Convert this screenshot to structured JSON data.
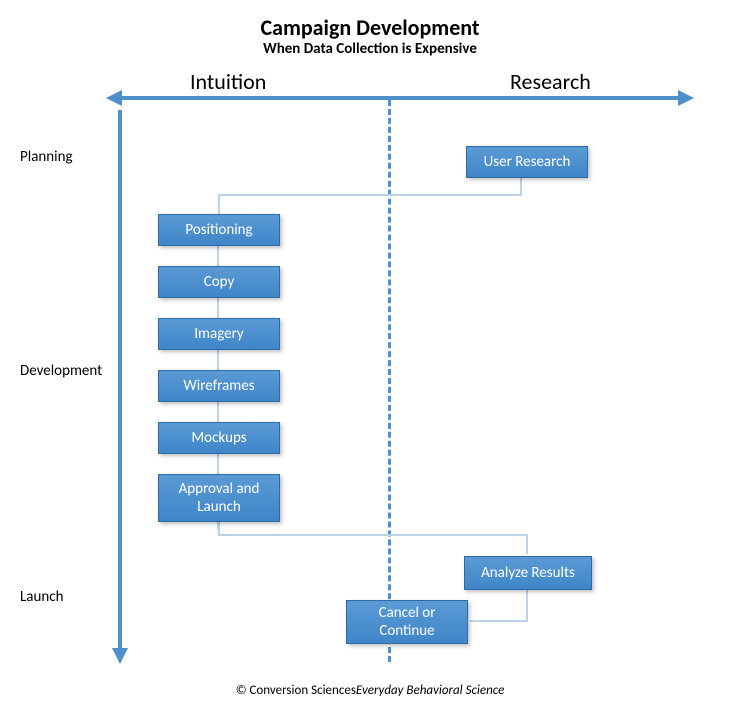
{
  "title": "Campaign Development",
  "subtitle": "When Data Collection is Expensive",
  "axes": {
    "left": "Intuition",
    "right": "Research"
  },
  "phases": {
    "planning": "Planning",
    "development": "Development",
    "launch": "Launch"
  },
  "nodes": {
    "user_research": "User Research",
    "positioning": "Positioning",
    "copy": "Copy",
    "imagery": "Imagery",
    "wireframes": "Wireframes",
    "mockups": "Mockups",
    "approval_launch": "Approval and\nLaunch",
    "analyze_results": "Analyze Results",
    "cancel_continue": "Cancel or\nContinue"
  },
  "footer": {
    "copyright": "© Conversion Sciences",
    "tagline": "Everyday Behavioral Science"
  }
}
